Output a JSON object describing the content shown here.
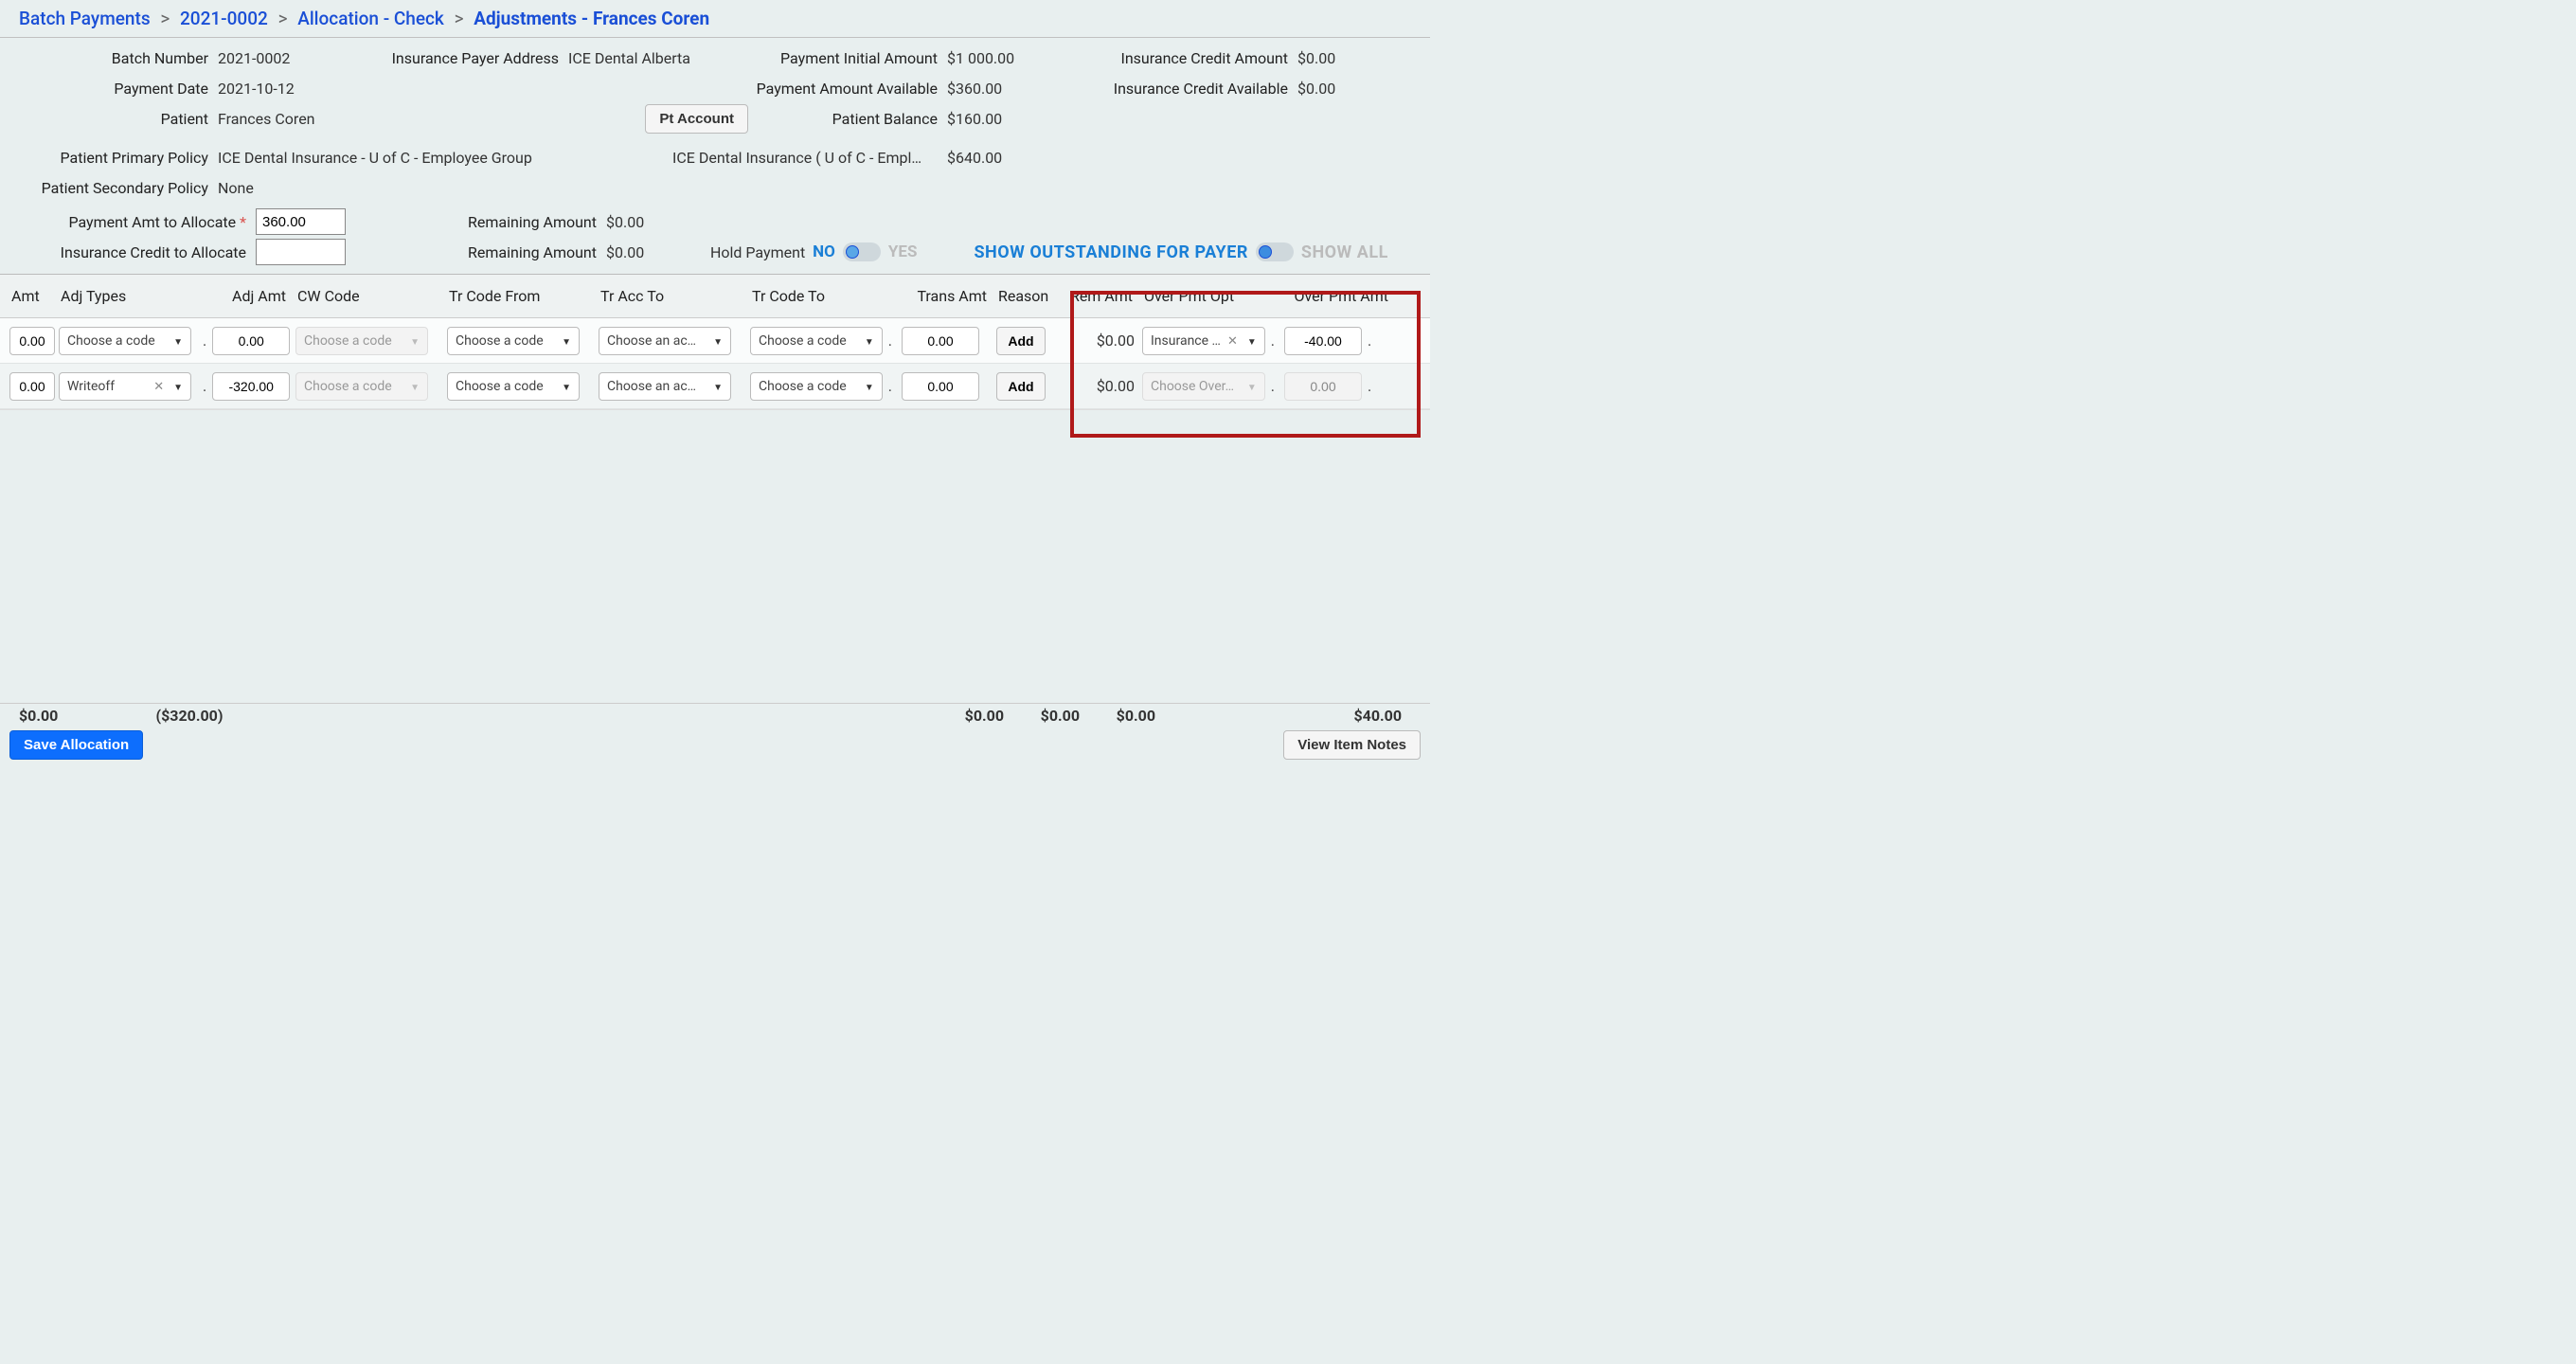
{
  "breadcrumb": {
    "items": [
      "Batch Payments",
      "2021-0002",
      "Allocation - Check"
    ],
    "current": "Adjustments - Frances Coren"
  },
  "header": {
    "batch_number_label": "Batch Number",
    "batch_number": "2021-0002",
    "payment_date_label": "Payment Date",
    "payment_date": "2021-10-12",
    "patient_label": "Patient",
    "patient": "Frances Coren",
    "payer_addr_label": "Insurance Payer Address",
    "payer_addr": "ICE Dental Alberta",
    "pt_account_btn": "Pt Account",
    "pmt_initial_label": "Payment Initial Amount",
    "pmt_initial": "$1 000.00",
    "pmt_avail_label": "Payment Amount Available",
    "pmt_avail": "$360.00",
    "pat_bal_label": "Patient Balance",
    "pat_bal": "$160.00",
    "ins_credit_amt_label": "Insurance Credit Amount",
    "ins_credit_amt": "$0.00",
    "ins_credit_avail_label": "Insurance Credit Available",
    "ins_credit_avail": "$0.00",
    "ppp_label": "Patient Primary Policy",
    "ppp": "ICE Dental Insurance - U of C - Employee Group",
    "ppp_short": "ICE Dental Insurance ( U of C - Empl…",
    "ppp_amt": "$640.00",
    "psp_label": "Patient Secondary Policy",
    "psp": "None",
    "pmt_alloc_label": "Payment Amt to Allocate",
    "pmt_alloc_val": "360.00",
    "ins_alloc_label": "Insurance Credit to Allocate",
    "ins_alloc_val": "",
    "rem1_label": "Remaining Amount",
    "rem1_val": "$0.00",
    "rem2_label": "Remaining Amount",
    "rem2_val": "$0.00",
    "hold_label": "Hold Payment",
    "hold_no": "NO",
    "hold_yes": "YES",
    "show_payer": "SHOW OUTSTANDING FOR PAYER",
    "show_all": "SHOW ALL"
  },
  "columns": {
    "amt": "Amt",
    "adj_types": "Adj Types",
    "adj_amt": "Adj Amt",
    "cw": "CW Code",
    "tr_from": "Tr Code From",
    "tr_acc": "Tr Acc To",
    "tr_to": "Tr Code To",
    "trans_amt": "Trans Amt",
    "reason": "Reason",
    "rem_amt": "Rem Amt",
    "over_opt": "Over Pmt Opt",
    "over_amt": "Over Pmt Amt"
  },
  "ph": {
    "choose_code": "Choose a code",
    "choose_acc": "Choose an ac…",
    "choose_over": "Choose Over…"
  },
  "rows": [
    {
      "amt": "0.00",
      "adj_type": "",
      "adj_amt": "0.00",
      "trans_amt": "0.00",
      "add": "Add",
      "rem": "$0.00",
      "over_opt": "Insurance …",
      "over_amt": "-40.00"
    },
    {
      "amt": "0.00",
      "adj_type": "Writeoff",
      "adj_amt": "-320.00",
      "trans_amt": "0.00",
      "add": "Add",
      "rem": "$0.00",
      "over_opt": "",
      "over_amt": "0.00"
    }
  ],
  "totals": {
    "amt": "$0.00",
    "adj": "($320.00)",
    "trans": "$0.00",
    "reason": "$0.00",
    "rem": "$0.00",
    "over": "$40.00"
  },
  "footer": {
    "save": "Save Allocation",
    "notes": "View Item Notes"
  }
}
